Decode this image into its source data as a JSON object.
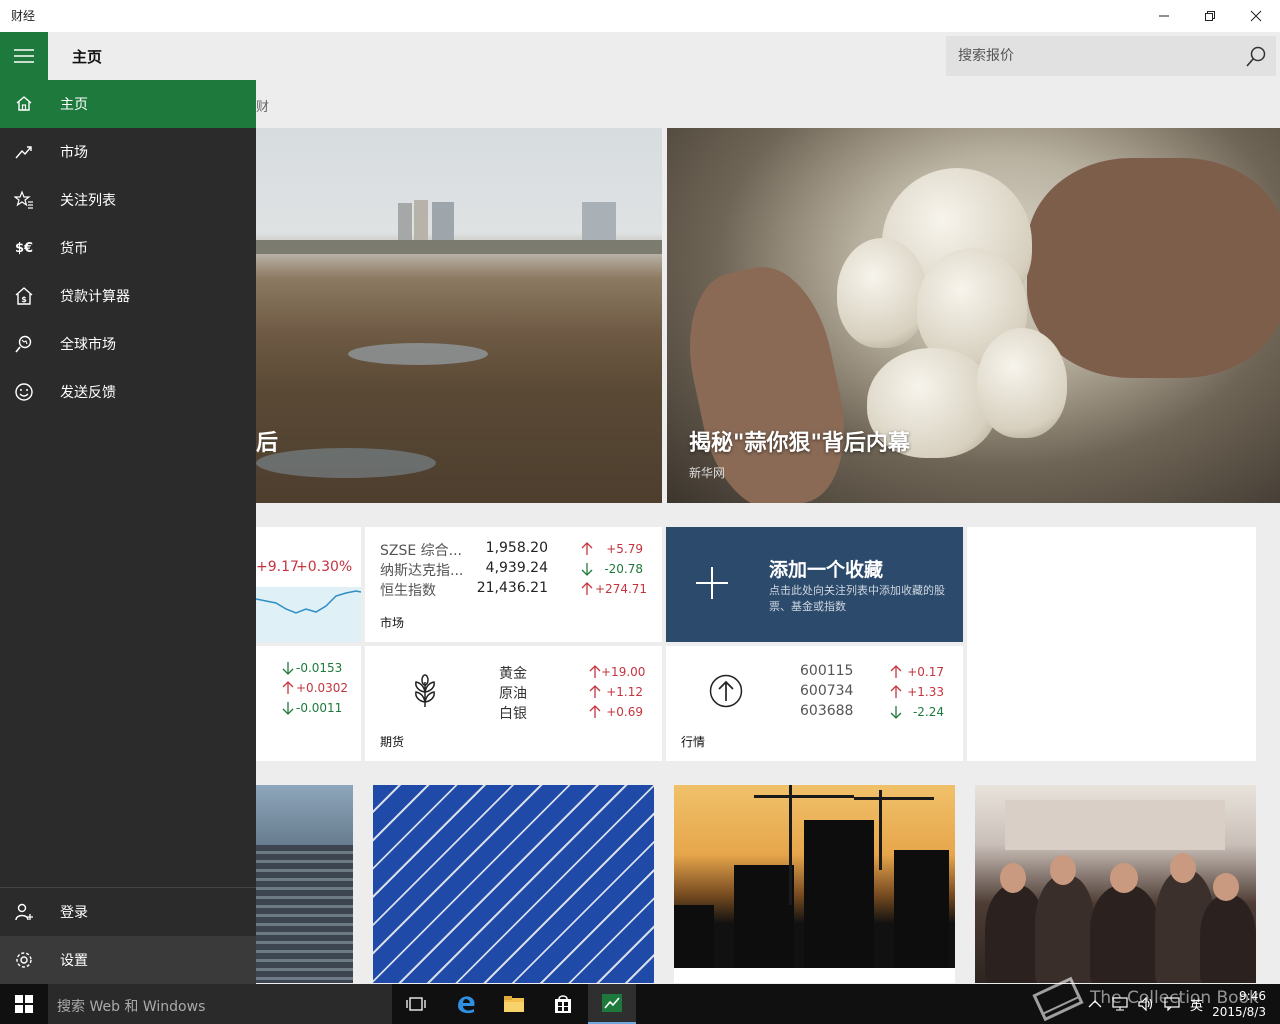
{
  "window": {
    "title": "财经"
  },
  "header": {
    "page_title": "主页",
    "search_placeholder": "搜索报价"
  },
  "nav": {
    "items": [
      {
        "label": "主页",
        "icon": "home-icon",
        "active": true
      },
      {
        "label": "市场",
        "icon": "trend-icon"
      },
      {
        "label": "关注列表",
        "icon": "star-list-icon"
      },
      {
        "label": "货币",
        "icon": "currency-icon"
      },
      {
        "label": "贷款计算器",
        "icon": "loan-calculator-icon"
      },
      {
        "label": "全球市场",
        "icon": "globe-icon"
      },
      {
        "label": "发送反馈",
        "icon": "smiley-icon"
      }
    ],
    "bottom": [
      {
        "label": "登录",
        "icon": "person-add-icon"
      },
      {
        "label": "设置",
        "icon": "gear-icon"
      }
    ],
    "currency_glyph": "$€"
  },
  "content": {
    "subnav_fragment": "财",
    "hero1_fragment": "后",
    "hero2": {
      "title": "揭秘\"蒜你狠\"背后内幕",
      "source": "新华网"
    },
    "index_tile": {
      "change": "+9.17",
      "change_pct": "+0.30%"
    },
    "market_tile": {
      "label": "市场",
      "rows": [
        {
          "name": "SZSE 综合...",
          "value": "1,958.20",
          "change": "+5.79",
          "dir": "up"
        },
        {
          "name": "纳斯达克指...",
          "value": "4,939.24",
          "change": "-20.78",
          "dir": "down"
        },
        {
          "name": "恒生指数",
          "value": "21,436.21",
          "change": "+274.71",
          "dir": "up"
        }
      ]
    },
    "add_tile": {
      "title": "添加一个收藏",
      "desc": "点击此处向关注列表中添加收藏的股票、基金或指数"
    },
    "fx_tile": {
      "rows": [
        {
          "change": "-0.0153",
          "dir": "down"
        },
        {
          "change": "+0.0302",
          "dir": "up"
        },
        {
          "change": "-0.0011",
          "dir": "down"
        }
      ]
    },
    "futures_tile": {
      "label": "期货",
      "rows": [
        {
          "name": "黄金",
          "change": "+19.00",
          "dir": "up"
        },
        {
          "name": "原油",
          "change": "+1.12",
          "dir": "up"
        },
        {
          "name": "白银",
          "change": "+0.69",
          "dir": "up"
        }
      ]
    },
    "quotes_tile": {
      "label": "行情",
      "rows": [
        {
          "code": "600115",
          "change": "+0.17",
          "dir": "up"
        },
        {
          "code": "600734",
          "change": "+1.33",
          "dir": "up"
        },
        {
          "code": "603688",
          "change": "-2.24",
          "dir": "down"
        }
      ]
    }
  },
  "taskbar": {
    "search_text": "搜索 Web 和 Windows",
    "tray": {
      "ime": "英",
      "time": "9:46",
      "date": "2015/8/3"
    },
    "watermark": "The Collection Book"
  },
  "colors": {
    "accent": "#1e7a3c",
    "nav_bg": "#2b2b2b",
    "up": "#c4343f",
    "down": "#1e7a3c",
    "add_tile": "#2c4a6b"
  }
}
